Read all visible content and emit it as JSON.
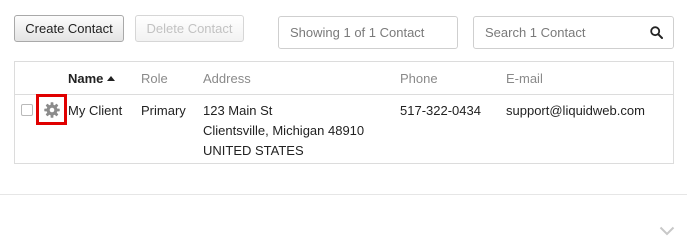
{
  "toolbar": {
    "create_label": "Create Contact",
    "delete_label": "Delete Contact",
    "showing_text": "Showing 1 of 1 Contact",
    "search_placeholder": "Search 1 Contact"
  },
  "table": {
    "columns": [
      {
        "key": "name",
        "label": "Name",
        "sorted": "asc"
      },
      {
        "key": "role",
        "label": "Role"
      },
      {
        "key": "address",
        "label": "Address"
      },
      {
        "key": "phone",
        "label": "Phone"
      },
      {
        "key": "email",
        "label": "E-mail"
      }
    ],
    "rows": [
      {
        "name": "My Client",
        "role": "Primary",
        "address_line1": "123 Main St",
        "address_line2": "Clientsville, Michigan 48910",
        "address_line3": "UNITED STATES",
        "phone": "517-322-0434",
        "email": "support@liquidweb.com"
      }
    ]
  },
  "icons": {
    "row_settings": "gear-icon",
    "search": "search-icon",
    "footer_toggle": "chevron-down-icon"
  },
  "colors": {
    "highlight": "#e00000",
    "header_text": "#8a8a8a",
    "border": "#dcdcdc"
  }
}
